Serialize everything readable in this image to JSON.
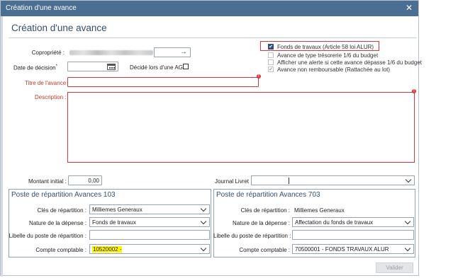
{
  "window": {
    "title": "Création d'une avance",
    "close_glyph": "✕"
  },
  "header": {
    "title": "Création d'une avance"
  },
  "form": {
    "copropriete_label": "Copropriété :",
    "copropriete_arrow": "→",
    "date_label": "Date de décision",
    "date_required_mark": "*",
    "ag_label": "Décidé lors d'une AG",
    "titre_label": "Titre de l'avance :",
    "description_label": "Description :",
    "montant_label": "Montant initial :",
    "montant_value": "0,00",
    "journal_label": "Journal Livret :",
    "alert_glyph": "!"
  },
  "options": [
    {
      "label": "Fonds de travaux (Article 58 loi ALUR)",
      "checked": true
    },
    {
      "label": "Avance de type trésorerie 1/6 du budget",
      "checked": false
    },
    {
      "label": "Afficher une alerte si cette avance dépasse 1/6 du budget",
      "checked": false
    },
    {
      "label": "Avance non remboursable (Rattachée au lot)",
      "checked": true
    }
  ],
  "check_glyph": "✔",
  "left_group": {
    "title": "Poste de répartition Avances 103",
    "cles_label": "Clés de répartition :",
    "cles_value": "Milliemes Generaux",
    "nature_label": "Nature de la dépense :",
    "nature_value": "Fonds de travaux",
    "libelle_label": "Libelle du poste de répartition :",
    "compte_label": "Compte comptable :",
    "compte_value": "10520002   -"
  },
  "right_group": {
    "title": "Poste de répartition Avances 703",
    "cles_label": "Clés de répartition :",
    "cles_value": "Milliemes Generaux",
    "nature_label": "Nature de la dépense :",
    "nature_value": "Affectation du fonds de travaux",
    "libelle_label": "Libelle du poste de répartition :",
    "compte_label": "Compte comptable :",
    "compte_value": "70500001   - FONDS TRAVAUX ALUR"
  },
  "footer": {
    "valider_label": "Valider"
  },
  "colors": {
    "titlebar": "#4a6f93",
    "header_text": "#34506e",
    "required_red": "#d9363e",
    "highlight": "#fff500"
  }
}
